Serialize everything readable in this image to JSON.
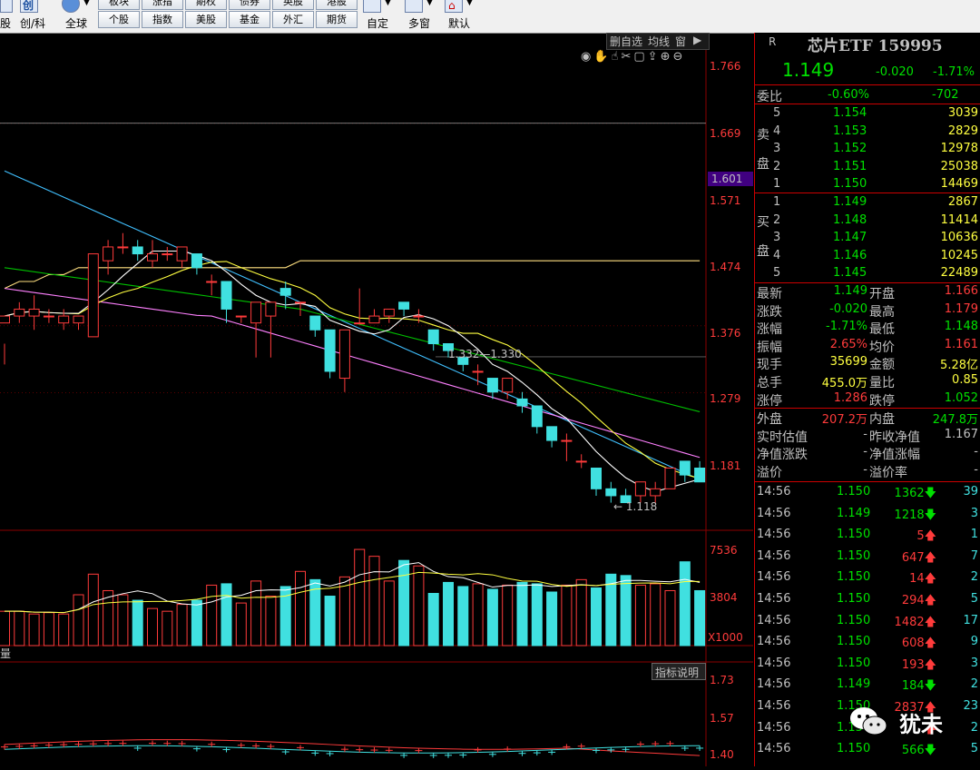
{
  "toolbar": {
    "left_top": [
      "股",
      "创/科",
      "全球"
    ],
    "tabs_top": [
      "板块",
      "涨指",
      "期权",
      "债券",
      "英股",
      "港股"
    ],
    "tabs_bottom": [
      "个股",
      "指数",
      "美股",
      "基金",
      "外汇",
      "期货"
    ],
    "right": [
      "自定",
      "多窗",
      "默认"
    ]
  },
  "chart": {
    "controls": [
      "删自选",
      "均线",
      "窗",
      "▶"
    ],
    "price_ticks": [
      "1.766",
      "1.669",
      "1.571",
      "1.474",
      "1.376",
      "1.279",
      "1.181"
    ],
    "price_highlight": "1.601",
    "annot_range": "1.332—1.330",
    "annot_low": "← 1.118",
    "vol_ticks": [
      "7536",
      "3804"
    ],
    "vol_unit": "X1000",
    "ind_label": "量",
    "ind_button": "指标说明",
    "ind_ticks": [
      "1.73",
      "1.57",
      "1.40"
    ],
    "colors": {
      "up": "#ff3b3b",
      "down": "#40e0e0",
      "ma5": "#ffffff",
      "ma10": "#ffff40",
      "ma20": "#ff80ff",
      "ma30": "#00c000",
      "ma60": "#40c0ff",
      "ma120": "#ffe080"
    }
  },
  "chart_data": {
    "type": "candlestick",
    "candles": [
      [
        1.38,
        1.39,
        1.35,
        1.32
      ],
      [
        1.39,
        1.4,
        1.41,
        1.38
      ],
      [
        1.39,
        1.4,
        1.42,
        1.37
      ],
      [
        1.39,
        1.39,
        1.4,
        1.38
      ],
      [
        1.38,
        1.39,
        1.4,
        1.37
      ],
      [
        1.38,
        1.39,
        1.39,
        1.37
      ],
      [
        1.36,
        1.48,
        1.48,
        1.36
      ],
      [
        1.47,
        1.49,
        1.5,
        1.45
      ],
      [
        1.49,
        1.49,
        1.51,
        1.48
      ],
      [
        1.49,
        1.48,
        1.5,
        1.47
      ],
      [
        1.47,
        1.48,
        1.5,
        1.46
      ],
      [
        1.48,
        1.48,
        1.49,
        1.47
      ],
      [
        1.47,
        1.49,
        1.49,
        1.46
      ],
      [
        1.48,
        1.46,
        1.48,
        1.45
      ],
      [
        1.44,
        1.44,
        1.45,
        1.42
      ],
      [
        1.44,
        1.4,
        1.44,
        1.38
      ],
      [
        1.39,
        1.39,
        1.39,
        1.38
      ],
      [
        1.38,
        1.41,
        1.41,
        1.33
      ],
      [
        1.39,
        1.41,
        1.41,
        1.33
      ],
      [
        1.43,
        1.42,
        1.44,
        1.4
      ],
      [
        1.41,
        1.41,
        1.41,
        1.39
      ],
      [
        1.39,
        1.37,
        1.39,
        1.36
      ],
      [
        1.37,
        1.31,
        1.37,
        1.3
      ],
      [
        1.3,
        1.37,
        1.37,
        1.28
      ],
      [
        1.38,
        1.38,
        1.43,
        1.38
      ],
      [
        1.38,
        1.39,
        1.4,
        1.38
      ],
      [
        1.39,
        1.4,
        1.4,
        1.38
      ],
      [
        1.41,
        1.4,
        1.41,
        1.39
      ],
      [
        1.39,
        1.39,
        1.4,
        1.38
      ],
      [
        1.37,
        1.35,
        1.37,
        1.34
      ],
      [
        1.35,
        1.34,
        1.35,
        1.33
      ],
      [
        1.33,
        1.32,
        1.33,
        1.31
      ],
      [
        1.31,
        1.31,
        1.32,
        1.29
      ],
      [
        1.3,
        1.28,
        1.3,
        1.27
      ],
      [
        1.28,
        1.3,
        1.3,
        1.27
      ],
      [
        1.27,
        1.26,
        1.28,
        1.25
      ],
      [
        1.26,
        1.23,
        1.26,
        1.22
      ],
      [
        1.23,
        1.21,
        1.23,
        1.2
      ],
      [
        1.21,
        1.21,
        1.22,
        1.18
      ],
      [
        1.18,
        1.18,
        1.19,
        1.17
      ],
      [
        1.17,
        1.14,
        1.17,
        1.13
      ],
      [
        1.14,
        1.13,
        1.15,
        1.12
      ],
      [
        1.13,
        1.12,
        1.14,
        1.12
      ],
      [
        1.13,
        1.15,
        1.15,
        1.12
      ],
      [
        1.13,
        1.14,
        1.15,
        1.12
      ],
      [
        1.14,
        1.17,
        1.17,
        1.14
      ],
      [
        1.18,
        1.16,
        1.18,
        1.15
      ],
      [
        1.17,
        1.15,
        1.18,
        1.15
      ]
    ],
    "volumes": [
      2.5,
      2.5,
      2.3,
      2.4,
      2.3,
      3.7,
      5.2,
      4.0,
      3.7,
      3.3,
      2.7,
      2.5,
      3.0,
      3.3,
      4.4,
      4.5,
      3.1,
      4.7,
      3.6,
      4.3,
      5.4,
      4.8,
      3.6,
      5.0,
      7.0,
      6.5,
      4.7,
      6.2,
      5.8,
      3.8,
      4.6,
      4.3,
      4.5,
      4.1,
      4.4,
      4.6,
      4.5,
      3.9,
      4.4,
      4.8,
      4.2,
      5.2,
      5.1,
      4.4,
      4.5,
      4.0,
      6.1,
      4.0
    ],
    "ma120": [
      1.43,
      1.44,
      1.44,
      1.45,
      1.45,
      1.46,
      1.46,
      1.46,
      1.46,
      1.46,
      1.46,
      1.46,
      1.46,
      1.46,
      1.46,
      1.46,
      1.46,
      1.46,
      1.46,
      1.46,
      1.47,
      1.47,
      1.47,
      1.47,
      1.47,
      1.47,
      1.47,
      1.47,
      1.47,
      1.47,
      1.47,
      1.47,
      1.47,
      1.47,
      1.47,
      1.47,
      1.47,
      1.47,
      1.47,
      1.47,
      1.47,
      1.47,
      1.47,
      1.47,
      1.47,
      1.47,
      1.47,
      1.47
    ],
    "price_range": [
      1.08,
      1.8
    ]
  },
  "quote": {
    "badge": "R",
    "title": "芯片ETF 159995",
    "price": "1.149",
    "change": "-0.020",
    "pct": "-1.71%",
    "ratio_label": "委比",
    "ratio": "-0.60%",
    "ratio_diff": "-702",
    "sell_label": [
      "卖",
      "盘"
    ],
    "buy_label": [
      "买",
      "盘"
    ],
    "asks": [
      [
        "5",
        "1.154",
        "3039"
      ],
      [
        "4",
        "1.153",
        "2829"
      ],
      [
        "3",
        "1.152",
        "12978"
      ],
      [
        "2",
        "1.151",
        "25038"
      ],
      [
        "1",
        "1.150",
        "14469"
      ]
    ],
    "bids": [
      [
        "1",
        "1.149",
        "2867"
      ],
      [
        "2",
        "1.148",
        "11414"
      ],
      [
        "3",
        "1.147",
        "10636"
      ],
      [
        "4",
        "1.146",
        "10245"
      ],
      [
        "5",
        "1.145",
        "22489"
      ]
    ],
    "stats": [
      [
        "最新",
        "1.149",
        "开盘",
        "1.166"
      ],
      [
        "涨跌",
        "-0.020",
        "最高",
        "1.179"
      ],
      [
        "涨幅",
        "-1.71%",
        "最低",
        "1.148"
      ],
      [
        "振幅",
        "2.65%",
        "均价",
        "1.161"
      ],
      [
        "现手",
        "35699",
        "金额",
        "5.28亿"
      ],
      [
        "总手",
        "455.0万",
        "量比",
        "0.85"
      ],
      [
        "涨停",
        "1.286",
        "跌停",
        "1.052"
      ]
    ],
    "stats2": [
      [
        "外盘",
        "207.2万",
        "内盘",
        "247.8万"
      ],
      [
        "实时估值",
        "-",
        "昨收净值",
        "1.167"
      ],
      [
        "净值涨跌",
        "-",
        "净值涨幅",
        "-"
      ],
      [
        "溢价",
        "-",
        "溢价率",
        "-"
      ]
    ],
    "ticks": [
      [
        "14:56",
        "1.150",
        "1362",
        "down",
        "39"
      ],
      [
        "14:56",
        "1.149",
        "1218",
        "down",
        "3"
      ],
      [
        "14:56",
        "1.150",
        "5",
        "up",
        "1"
      ],
      [
        "14:56",
        "1.150",
        "647",
        "up",
        "7"
      ],
      [
        "14:56",
        "1.150",
        "14",
        "up",
        "2"
      ],
      [
        "14:56",
        "1.150",
        "294",
        "up",
        "5"
      ],
      [
        "14:56",
        "1.150",
        "1482",
        "up",
        "17"
      ],
      [
        "14:56",
        "1.150",
        "608",
        "up",
        "9"
      ],
      [
        "14:56",
        "1.150",
        "193",
        "up",
        "3"
      ],
      [
        "14:56",
        "1.149",
        "184",
        "down",
        "2"
      ],
      [
        "14:56",
        "1.150",
        "2837",
        "up",
        "23"
      ],
      [
        "14:56",
        "1.150",
        "",
        "up",
        "2"
      ],
      [
        "14:56",
        "1.150",
        "566",
        "down",
        "5"
      ]
    ],
    "watermark": "犹未"
  }
}
